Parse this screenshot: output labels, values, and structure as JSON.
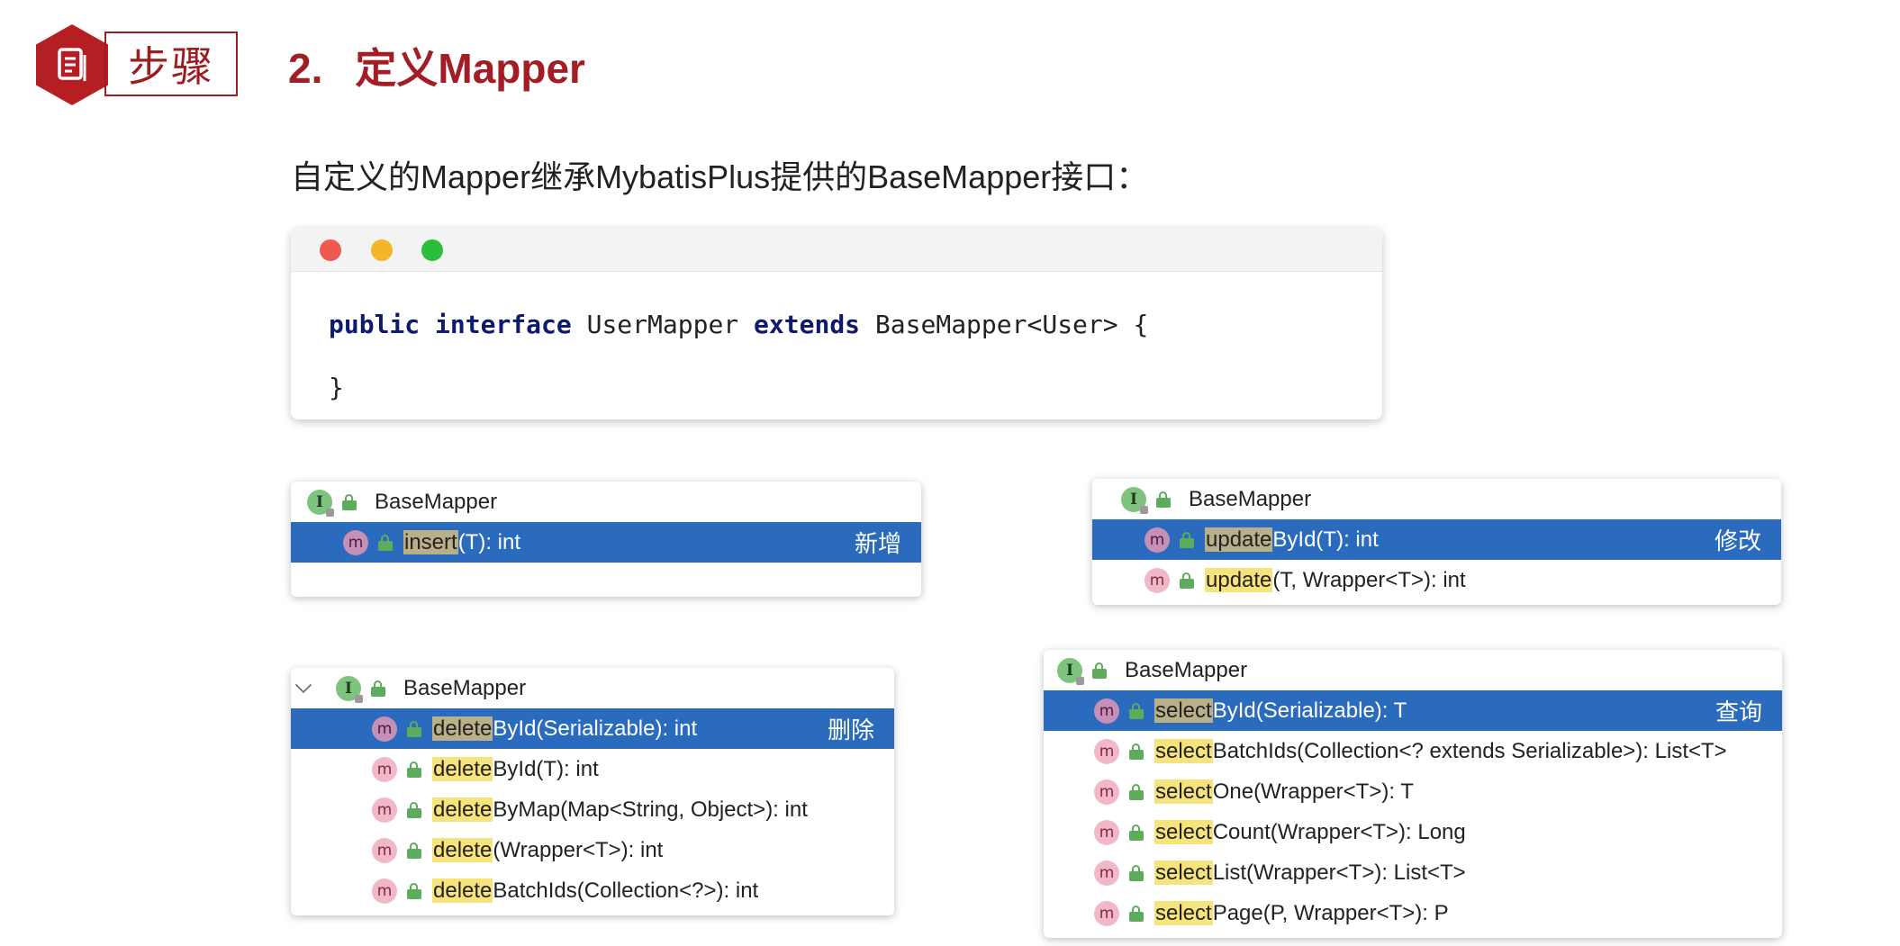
{
  "header": {
    "badge_icon": "document-icon",
    "badge_label": "步骤",
    "number": "2.",
    "title": "定义Mapper"
  },
  "intro": "自定义的Mapper继承MybatisPlus提供的BaseMapper接口：",
  "code": {
    "kw_public": "public",
    "kw_interface": "interface",
    "name": "UserMapper",
    "kw_extends": "extends",
    "base": "BaseMapper<User> {",
    "close": "}"
  },
  "panels": {
    "insert": {
      "header": "BaseMapper",
      "rows": [
        {
          "hl": "insert",
          "rest": "(T): int",
          "label": "新增"
        }
      ]
    },
    "update": {
      "header": "BaseMapper",
      "rows": [
        {
          "hl": "update",
          "rest": "ById(T): int",
          "label": "修改"
        },
        {
          "hl": "update",
          "rest": "(T, Wrapper<T>): int"
        }
      ]
    },
    "delete": {
      "header": "BaseMapper",
      "rows": [
        {
          "hl": "delete",
          "rest": "ById(Serializable): int",
          "label": "删除"
        },
        {
          "hl": "delete",
          "rest": "ById(T): int"
        },
        {
          "hl": "delete",
          "rest": "ByMap(Map<String, Object>): int"
        },
        {
          "hl": "delete",
          "rest": "(Wrapper<T>): int"
        },
        {
          "hl": "delete",
          "rest": "BatchIds(Collection<?>): int"
        }
      ]
    },
    "select": {
      "header": "BaseMapper",
      "rows": [
        {
          "hl": "select",
          "rest": "ById(Serializable): T",
          "label": "查询"
        },
        {
          "hl": "select",
          "rest": "BatchIds(Collection<? extends Serializable>): List<T>"
        },
        {
          "hl": "select",
          "rest": "One(Wrapper<T>): T"
        },
        {
          "hl": "select",
          "rest": "Count(Wrapper<T>): Long"
        },
        {
          "hl": "select",
          "rest": "List(Wrapper<T>): List<T>"
        },
        {
          "hl": "select",
          "rest": "Page(P, Wrapper<T>): P"
        }
      ]
    }
  },
  "icons": {
    "interface": "I",
    "method": "m"
  },
  "colors": {
    "brand": "#b51f24",
    "selection": "#2a6bbd",
    "highlight": "#f7e37c"
  }
}
